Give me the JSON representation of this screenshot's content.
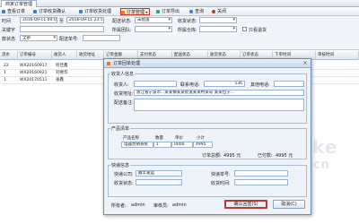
{
  "window": {
    "tab_label": "商家订单管理"
  },
  "toolbar": {
    "buttons": [
      {
        "label": "查看订单"
      },
      {
        "label": "订单收货确认"
      },
      {
        "label": "订单收货处理"
      },
      {
        "label": "订单管理"
      },
      {
        "label": "订单导出"
      },
      {
        "label": "查询"
      },
      {
        "label": "关闭"
      }
    ],
    "colors": {
      "icon": "#3b7dd8",
      "selected_border": "#c0392b"
    }
  },
  "filter": {
    "time_label": "时间",
    "date_from": "2016-09-11 00:00",
    "to_label": "至",
    "date_to": "2016-09-11 23:59",
    "ship_status_label": "配送状态:",
    "ship_status_value": "未配送",
    "receive_status_label": "收货状态:",
    "keyword_label": "关键字",
    "team_label": "所属团队:",
    "pickup_label": "所属仓库:",
    "only_label": "只看退货",
    "order_status_label": "款状态",
    "order_status_value": "全部",
    "delivery_label": "配送单号:"
  },
  "grid": {
    "headers": [
      "流水",
      "订单编号",
      "收货人",
      "收货地址",
      "订单金额",
      "支付状态",
      "配送状态",
      "收货状态",
      "订单状态",
      "下单时间",
      "审核时间"
    ],
    "rows": [
      {
        "no": "22",
        "order": "WX20160917",
        "name": "何佳鑫",
        "addr": ""
      },
      {
        "no": "1",
        "order": "WX20160921",
        "name": "刘德华",
        "addr": ""
      },
      {
        "no": "1",
        "order": "WX20170511",
        "name": "张鑫",
        "addr": ""
      }
    ]
  },
  "dialog": {
    "title": "订单回单处理",
    "receiver_group": "收货人信息",
    "receiver_label": "收货人:",
    "receiver_value": "",
    "phone_label": "联系电话:",
    "phone_value": "536",
    "other_phone_label": "其他电话:",
    "addr_label": "收货地址:",
    "addr_value": "浙江省宁波市...某某镇某某街道某某村某号 某某位于...",
    "note_label": "配送备注:",
    "product_group": "产品清单",
    "product_cols": [
      "产品名称",
      "数量",
      "单价",
      "小计"
    ],
    "product_row": {
      "name": "电器营销系统",
      "qty": "1",
      "price": "0000",
      "subtotal": "4995"
    },
    "order_total_label": "订单总额:",
    "order_total_value": "4995 元",
    "paid_label": "已付款:",
    "paid_value": "4995 元",
    "ship_group": "快递信息",
    "courier_label": "快递公司:",
    "courier_value": "顺丰速运",
    "tracking_label": "快递单号:",
    "receive_status_label": "收货状态:",
    "receive_status_value": "",
    "signer_label": "收货时间:",
    "owner_label": "所有者:",
    "owner_value": "admin",
    "review_label": "审核员:",
    "review_value": "admin",
    "confirm_label": "确认回签(S)",
    "cancel_label": "取消(C)"
  },
  "watermark": {
    "big": "laoke",
    "small": "com.cn"
  }
}
